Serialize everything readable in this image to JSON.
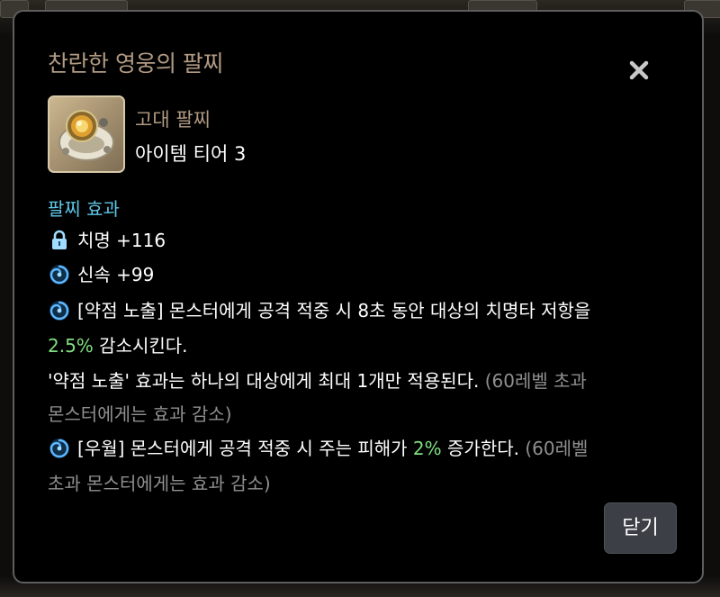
{
  "background": {
    "tab_fragment": "...",
    "tab_fragment_right": "..."
  },
  "dialog": {
    "title": "찬란한 영웅의 팔찌",
    "close_icon": "close-icon",
    "item": {
      "grade": "고대 팔찌",
      "tier": "아이템 티어 3",
      "icon": "bracelet-item-icon"
    },
    "section_title": "팔찌 효과",
    "effects": {
      "crit": {
        "icon": "lock-icon",
        "text": "치명 +116"
      },
      "swift": {
        "icon": "swirl-icon",
        "text": "신속 +99"
      },
      "weakness": {
        "icon": "swirl-icon",
        "line1": "[약점 노출] 몬스터에게 공격 적중 시 8초 동안 대상의 치명타 저항을",
        "value": "2.5%",
        "line2_rest": " 감소시킨다.",
        "line3_main": "'약점 노출' 효과는 하나의 대상에게 최대 1개만 적용된다.",
        "line3_note": " (60레벨 초과",
        "line4_note": "몬스터에게는 효과 감소)"
      },
      "superiority": {
        "icon": "swirl-icon",
        "line1_main": "[우월] 몬스터에게 공격 적중 시 주는 피해가 ",
        "value": "2%",
        "line1_rest": " 증가한다.",
        "line1_note": " (60레벨",
        "line2_note": "초과 몬스터에게는 효과 감소)"
      }
    },
    "close_button_label": "닫기"
  },
  "colors": {
    "title": "#b19a83",
    "section": "#5fc6e6",
    "highlight": "#7fe07f",
    "note": "#8f8f8f",
    "button_bg": "#3c3f45"
  }
}
